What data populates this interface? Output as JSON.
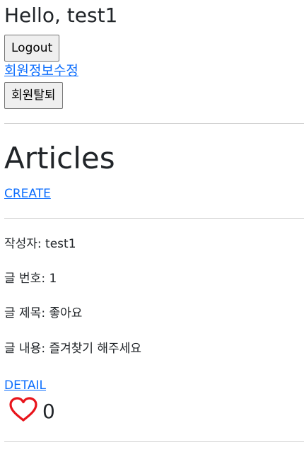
{
  "header": {
    "greeting": "Hello, test1",
    "logout_label": "Logout",
    "edit_profile_label": "회원정보수정",
    "withdraw_label": "회원탈퇴"
  },
  "main": {
    "title": "Articles",
    "create_label": "CREATE"
  },
  "article": {
    "author": "작성자: test1",
    "number": "글 번호: 1",
    "subject": "글 제목: 좋아요",
    "content": "글 내용: 즐겨찾기 해주세요",
    "detail_label": "DETAIL",
    "like_count": "0",
    "like_icon": "heart-outline-icon",
    "like_color": "#e8141b"
  },
  "colors": {
    "link": "#0d6efd",
    "text": "#212529",
    "button_bg": "#efefef"
  }
}
